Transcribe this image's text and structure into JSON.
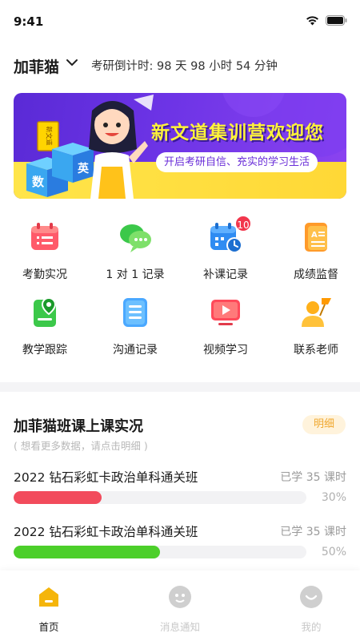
{
  "status_bar": {
    "time": "9:41"
  },
  "header": {
    "user_name": "加菲猫",
    "countdown": "考研倒计时: 98 天 98 小时 54 分钟"
  },
  "banner": {
    "title": "新文道集训营欢迎您",
    "subtitle": "开启考研自信、充实的学习生活",
    "book_label": "新文道",
    "cube_labels": [
      "数",
      "英"
    ]
  },
  "grid": {
    "items": [
      {
        "label": "考勤实况",
        "icon": "calendar-list-icon"
      },
      {
        "label": "1 对 1 记录",
        "icon": "chat-bubbles-icon"
      },
      {
        "label": "补课记录",
        "icon": "calendar-clock-icon",
        "badge": "10"
      },
      {
        "label": "成绩监督",
        "icon": "grade-sheet-icon"
      },
      {
        "label": "教学跟踪",
        "icon": "location-doc-icon"
      },
      {
        "label": "沟通记录",
        "icon": "notes-icon"
      },
      {
        "label": "视频学习",
        "icon": "video-play-icon"
      },
      {
        "label": "联系老师",
        "icon": "teacher-icon"
      }
    ]
  },
  "section": {
    "title": "加菲猫班课上课实况",
    "detail_label": "明细",
    "hint": "( 想看更多数据，请点击明细 )"
  },
  "courses": [
    {
      "name": "2022 钻石彩虹卡政治单科通关班",
      "hours": "已学 35 课时",
      "percent": "30%",
      "progress": 0.3,
      "color": "#f24b5c"
    },
    {
      "name": "2022 钻石彩虹卡政治单科通关班",
      "hours": "已学 35 课时",
      "percent": "50%",
      "progress": 0.5,
      "color": "#4ccf2a"
    }
  ],
  "bottom_nav": {
    "items": [
      {
        "label": "首页",
        "active": true
      },
      {
        "label": "消息通知",
        "active": false
      },
      {
        "label": "我的",
        "active": false
      }
    ]
  },
  "colors": {
    "accent": "#f5b50a",
    "active_label": "#1a1a1a",
    "inactive": "#c8c8c8"
  }
}
